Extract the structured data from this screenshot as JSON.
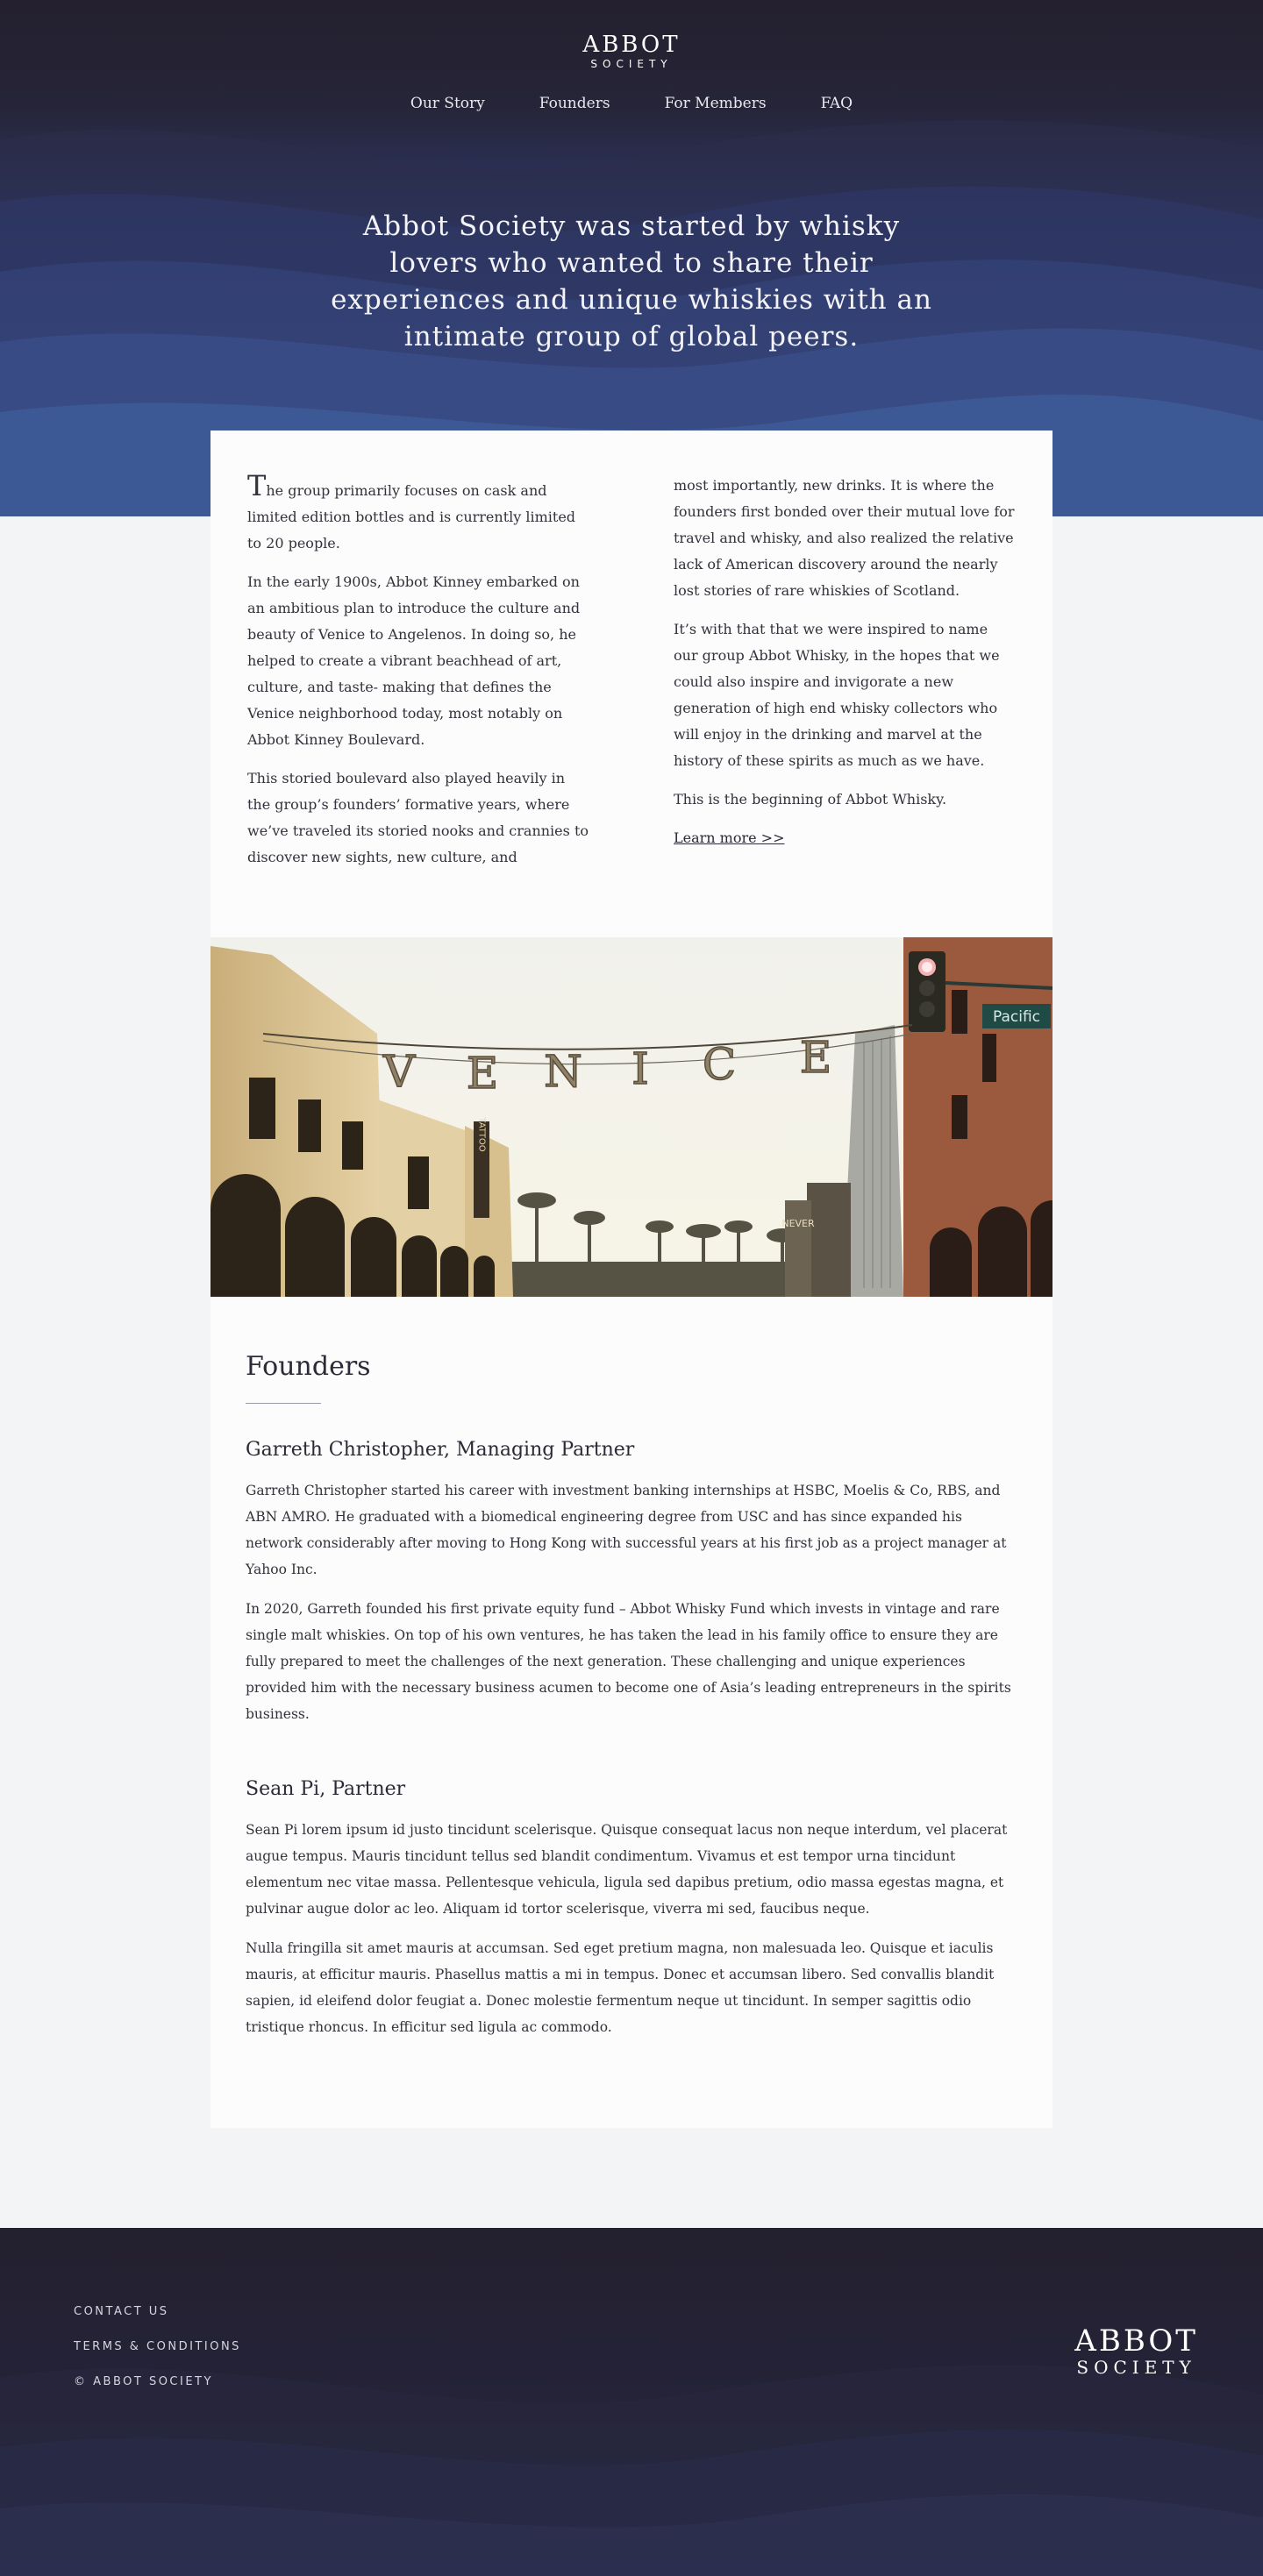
{
  "brand": {
    "name": "ABBOT",
    "subname": "SOCIETY"
  },
  "nav": [
    "Our Story",
    "Founders",
    "For Members",
    "FAQ"
  ],
  "hero": {
    "title": "Abbot Society was started by whisky lovers who wanted to share their experiences and unique whiskies with an intimate group of global peers."
  },
  "intro": {
    "dropcap": "T",
    "p1_rest": "he group primarily focuses on cask and limited edition bottles and is currently limited to 20 people.",
    "p2": "In the early 1900s, Abbot Kinney embarked on an ambitious plan to introduce the culture and beauty of Venice to Angelenos. In doing so, he helped to create a vibrant beachhead of art, culture, and taste- making that defines the Venice neighborhood today, most notably on Abbot Kinney Boulevard.",
    "p3": "This storied boulevard also played heavily in the group’s founders’ formative years, where we’ve traveled its storied nooks and crannies to discover new sights, new culture, and",
    "p4": "most importantly, new drinks. It is where the founders first bonded over their mutual love for travel and whisky, and also realized the relative lack of American discovery around the nearly lost stories of rare whiskies of Scotland.",
    "p5": "It’s with that that we were inspired to name our group Abbot Whisky, in the hopes that we could also inspire and invigorate a new generation of high end whisky collectors who will enjoy in the drinking and marvel at the history of these spirits as much as we have.",
    "p6": "This is the beginning of Abbot Whisky.",
    "learn_more": "Learn more >>"
  },
  "photo": {
    "sign_letters": [
      "V",
      "E",
      "N",
      "I",
      "C",
      "E"
    ],
    "street_sign": "Pacific",
    "tattoo_sign": "TATTOO",
    "small_sign": "NEVER"
  },
  "founders": {
    "heading": "Founders",
    "people": [
      {
        "name": "Garreth Christopher, Managing Partner",
        "paragraphs": [
          "Garreth Christopher started his career with investment banking internships at HSBC, Moelis & Co, RBS, and ABN AMRO. He graduated with a biomedical engineering degree from USC and has since expanded his network considerably after moving to Hong Kong with successful years at his first job as a project manager at Yahoo Inc.",
          "In 2020, Garreth founded his first private equity fund – Abbot Whisky Fund which invests in vintage and rare single malt whiskies. On top of his own ventures, he has taken the lead in his family office to ensure they are fully prepared to meet the challenges of the next generation. These challenging and unique experiences provided him with the necessary business acumen to become one of Asia’s leading entrepreneurs in the spirits business."
        ]
      },
      {
        "name": "Sean Pi, Partner",
        "paragraphs": [
          "Sean Pi lorem ipsum id justo tincidunt scelerisque. Quisque consequat lacus non neque interdum, vel placerat augue tempus. Mauris tincidunt tellus sed blandit condimentum. Vivamus et est tempor urna tincidunt elementum nec vitae massa. Pellentesque vehicula, ligula sed dapibus pretium, odio massa egestas magna, et pulvinar augue dolor ac leo. Aliquam id tortor scelerisque, viverra mi sed, faucibus neque.",
          "Nulla fringilla sit amet mauris at accumsan. Sed eget pretium magna, non malesuada leo. Quisque et iaculis mauris, at efficitur mauris. Phasellus mattis a mi in tempus. Donec et accumsan libero. Sed convallis blandit sapien, id eleifend dolor feugiat a. Donec molestie fermentum neque ut tincidunt. In semper sagittis odio tristique rhoncus. In efficitur sed ligula ac commodo."
        ]
      }
    ]
  },
  "footer": {
    "links": [
      "CONTACT US",
      "TERMS & CONDITIONS"
    ],
    "copyright": "© ABBOT SOCIETY"
  },
  "colors": {
    "hero_top": "#24202f",
    "hero_bottom": "#4262a3",
    "page_bg": "#f3f4f6",
    "card_bg": "#fcfcfc",
    "footer_bg": "#252338"
  }
}
